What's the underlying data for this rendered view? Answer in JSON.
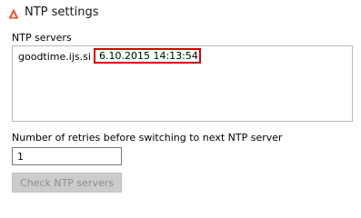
{
  "header": {
    "title": "NTP settings",
    "icon": "app-logo-icon",
    "icon_color": "#e8502d"
  },
  "servers": {
    "label": "NTP servers",
    "items": [
      {
        "host": "goodtime.ijs.si...",
        "time": "6.10.2015 14:13:54"
      }
    ],
    "highlight_color": "#d20000"
  },
  "retries": {
    "label": "Number of retries before switching to next NTP server",
    "value": "1"
  },
  "check_button": {
    "label": "Check NTP servers",
    "enabled": false
  }
}
